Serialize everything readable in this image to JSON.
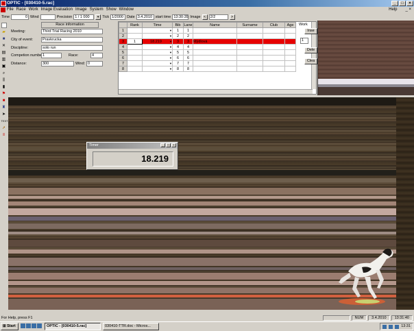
{
  "window": {
    "title": "OPTIC - [030410-5.rac]",
    "controls": [
      "_",
      "□",
      "×"
    ]
  },
  "menubar": {
    "items": [
      "File",
      "Race",
      "Work",
      "Image Evaluation",
      "Image",
      "System",
      "Show",
      "Window"
    ],
    "right": [
      "Help",
      "_ ×"
    ]
  },
  "toolbar": {
    "time_label": "Time",
    "time_value": "0",
    "wind_label": "Wind",
    "precision_label": "Precision",
    "precision_value": "1 / 1 000",
    "tick_label": "Tick",
    "tick_value": "1/2000",
    "date_label": "Date",
    "date_value": "3.4.2010",
    "start_label": "start time",
    "start_value": "13:30:35",
    "image_label": "Image",
    "image_value": "2/2"
  },
  "race_info": {
    "title": "Race information",
    "meeting_label": "Meeting:",
    "meeting_value": "Third Trial Racing 2010",
    "city_label": "City of event:",
    "city_value": "Pravkrucka",
    "discipline_label": "Discipline:",
    "discipline_value": "solo run",
    "competition_label": "Competion number:",
    "competition_value": "1",
    "race_label": "Race:",
    "race_value": "4",
    "distance_label": "Distance:",
    "distance_value": "300",
    "wind_label": "Wind:",
    "wind_value": "0"
  },
  "results": {
    "columns": [
      "",
      "Rank",
      "Time",
      "Bib",
      "Lane",
      "Name",
      "Surname",
      "Club",
      "Age"
    ],
    "rows": [
      {
        "n": "1",
        "rank": "",
        "time": "",
        "bib": "1",
        "lane": "1",
        "name": "",
        "selected": false
      },
      {
        "n": "2",
        "rank": "",
        "time": "",
        "bib": "2",
        "lane": "2",
        "name": "",
        "selected": false
      },
      {
        "n": "3",
        "rank": "1",
        "time": "18.219",
        "bib": "3",
        "lane": "3",
        "name": "Mýdlová",
        "selected": true
      },
      {
        "n": "4",
        "rank": "",
        "time": "",
        "bib": "4",
        "lane": "4",
        "name": "",
        "selected": false
      },
      {
        "n": "5",
        "rank": "",
        "time": "",
        "bib": "5",
        "lane": "5",
        "name": "",
        "selected": false
      },
      {
        "n": "6",
        "rank": "",
        "time": "",
        "bib": "6",
        "lane": "6",
        "name": "",
        "selected": false
      },
      {
        "n": "7",
        "rank": "",
        "time": "",
        "bib": "7",
        "lane": "7",
        "name": "",
        "selected": false
      },
      {
        "n": "8",
        "rank": "",
        "time": "",
        "bib": "8",
        "lane": "8",
        "name": "",
        "selected": false
      }
    ]
  },
  "work_panel": {
    "title": "Work",
    "buttons": [
      "Inse",
      "Dele",
      "Clea"
    ],
    "spin_value": "1"
  },
  "timer": {
    "title": "Timer",
    "value": "18.219"
  },
  "status": {
    "text": "For Help, press F1",
    "num": "NUM",
    "date": "3.4.2010",
    "time": "13:31:40"
  },
  "taskbar": {
    "start": "Start",
    "tasks": [
      "OPTIC - [030410-5.rac]",
      "030410-TTR.doc - Micros..."
    ],
    "clock": "13:31"
  }
}
